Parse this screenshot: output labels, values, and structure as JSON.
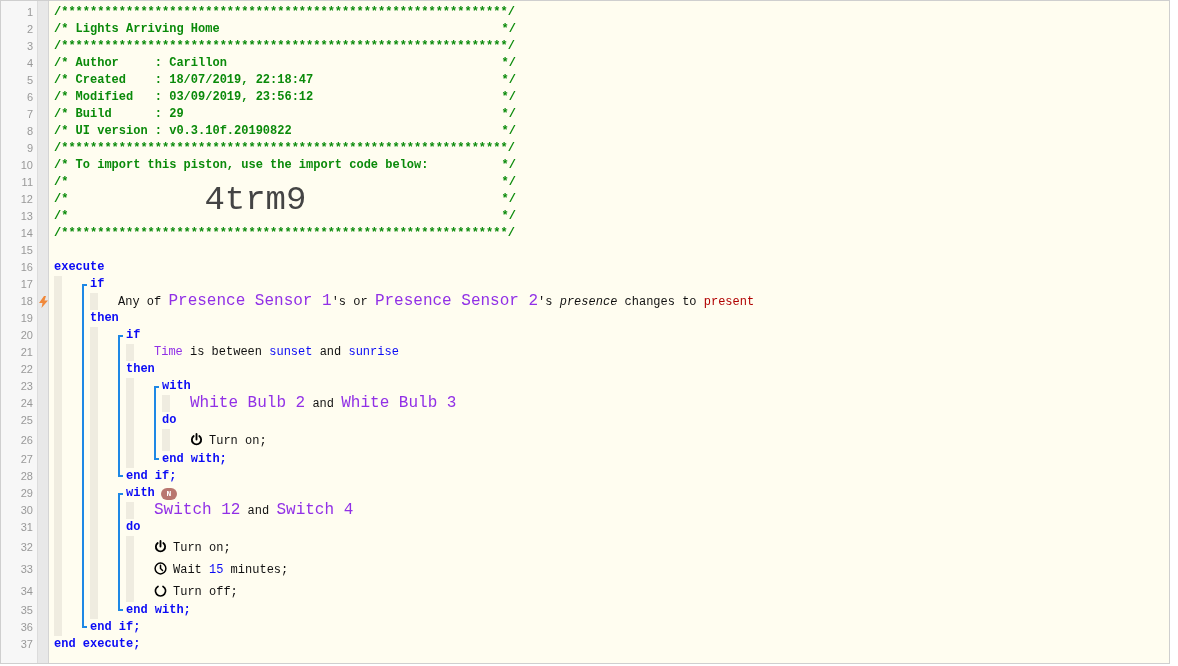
{
  "header": [
    {
      "number": "1",
      "left": "/**************************************************************/"
    },
    {
      "number": "2",
      "left": "/* Lights Arriving Home",
      "right": "*/"
    },
    {
      "number": "3",
      "left": "/**************************************************************/"
    },
    {
      "number": "4",
      "left": "/* Author     : Carillon",
      "right": "*/"
    },
    {
      "number": "5",
      "left": "/* Created    : 18/07/2019, 22:18:47",
      "right": "*/"
    },
    {
      "number": "6",
      "left": "/* Modified   : 03/09/2019, 23:56:12",
      "right": "*/"
    },
    {
      "number": "7",
      "left": "/* Build      : 29",
      "right": "*/"
    },
    {
      "number": "8",
      "left": "/* UI version : v0.3.10f.20190822",
      "right": "*/"
    },
    {
      "number": "9",
      "left": "/**************************************************************/"
    },
    {
      "number": "10",
      "left": "/* To import this piston, use the import code below:",
      "right": "*/"
    },
    {
      "number": "11",
      "left": "/*",
      "right": "*/"
    },
    {
      "number": "12",
      "left": "/*",
      "code": "4trm9",
      "right": "*/"
    },
    {
      "number": "13",
      "left": "/*",
      "right": "*/"
    },
    {
      "number": "14",
      "left": "/**************************************************************/"
    },
    {
      "number": "15"
    }
  ],
  "program": {
    "kind": "section",
    "parts": [
      {
        "line": {
          "number": "16",
          "tokens": [
            {
              "kind": "keyword",
              "text": "execute"
            }
          ]
        },
        "children": [
          {
            "kind": "block",
            "parts": [
              {
                "line": {
                  "number": "17",
                  "tokens": [
                    {
                      "kind": "keyword",
                      "text": "if"
                    }
                  ]
                },
                "children": [
                  {
                    "kind": "condition",
                    "trigger": true,
                    "number": "18",
                    "tokens": [
                      {
                        "kind": "text",
                        "text": "Any of "
                      },
                      {
                        "kind": "device",
                        "text": "Presence Sensor 1"
                      },
                      {
                        "kind": "text",
                        "text": "'s or "
                      },
                      {
                        "kind": "device",
                        "text": "Presence Sensor 2"
                      },
                      {
                        "kind": "text",
                        "text": "'s "
                      },
                      {
                        "kind": "attribute",
                        "text": "presence"
                      },
                      {
                        "kind": "text",
                        "text": " changes to "
                      },
                      {
                        "kind": "value",
                        "text": "present"
                      }
                    ]
                  }
                ]
              },
              {
                "line": {
                  "number": "19",
                  "tokens": [
                    {
                      "kind": "keyword",
                      "text": "then"
                    }
                  ]
                },
                "children": [
                  {
                    "kind": "block",
                    "parts": [
                      {
                        "line": {
                          "number": "20",
                          "tokens": [
                            {
                              "kind": "keyword",
                              "text": "if"
                            }
                          ]
                        },
                        "children": [
                          {
                            "kind": "condition",
                            "trigger": false,
                            "number": "21",
                            "tokens": [
                              {
                                "kind": "variable",
                                "text": "Time"
                              },
                              {
                                "kind": "text",
                                "text": " is between "
                              },
                              {
                                "kind": "constant",
                                "text": "sunset"
                              },
                              {
                                "kind": "text",
                                "text": " and "
                              },
                              {
                                "kind": "constant",
                                "text": "sunrise"
                              }
                            ]
                          }
                        ]
                      },
                      {
                        "line": {
                          "number": "22",
                          "tokens": [
                            {
                              "kind": "keyword",
                              "text": "then"
                            }
                          ]
                        },
                        "children": [
                          {
                            "kind": "block",
                            "parts": [
                              {
                                "line": {
                                  "number": "23",
                                  "tokens": [
                                    {
                                      "kind": "keyword",
                                      "text": "with"
                                    }
                                  ]
                                },
                                "children": [
                                  {
                                    "kind": "devices",
                                    "number": "24",
                                    "tokens": [
                                      {
                                        "kind": "device",
                                        "text": "White Bulb 2"
                                      },
                                      {
                                        "kind": "text",
                                        "text": " and "
                                      },
                                      {
                                        "kind": "device",
                                        "text": "White Bulb 3"
                                      }
                                    ]
                                  }
                                ]
                              },
                              {
                                "line": {
                                  "number": "25",
                                  "tokens": [
                                    {
                                      "kind": "keyword",
                                      "text": "do"
                                    }
                                  ]
                                },
                                "children": [
                                  {
                                    "kind": "turn_on",
                                    "number": "26",
                                    "tokens": [
                                      {
                                        "kind": "text",
                                        "text": "Turn on;"
                                      }
                                    ]
                                  }
                                ]
                              }
                            ],
                            "end": {
                              "number": "27",
                              "tokens": [
                                {
                                  "kind": "keyword",
                                  "text": "end with;"
                                }
                              ]
                            }
                          }
                        ]
                      }
                    ],
                    "end": {
                      "number": "28",
                      "tokens": [
                        {
                          "kind": "keyword",
                          "text": "end if;"
                        }
                      ]
                    }
                  },
                  {
                    "kind": "block",
                    "parts": [
                      {
                        "line": {
                          "number": "29",
                          "badge": "N",
                          "tokens": [
                            {
                              "kind": "keyword",
                              "text": "with"
                            }
                          ]
                        },
                        "children": [
                          {
                            "kind": "devices",
                            "number": "30",
                            "tokens": [
                              {
                                "kind": "device",
                                "text": "Switch 12"
                              },
                              {
                                "kind": "text",
                                "text": " and "
                              },
                              {
                                "kind": "device",
                                "text": "Switch 4"
                              }
                            ]
                          }
                        ]
                      },
                      {
                        "line": {
                          "number": "31",
                          "tokens": [
                            {
                              "kind": "keyword",
                              "text": "do"
                            }
                          ]
                        },
                        "children": [
                          {
                            "kind": "turn_on",
                            "number": "32",
                            "tokens": [
                              {
                                "kind": "text",
                                "text": "Turn on;"
                              }
                            ]
                          },
                          {
                            "kind": "wait",
                            "number": "33",
                            "tokens": [
                              {
                                "kind": "text",
                                "text": "Wait "
                              },
                              {
                                "kind": "number",
                                "text": "15"
                              },
                              {
                                "kind": "text",
                                "text": " minutes;"
                              }
                            ]
                          },
                          {
                            "kind": "turn_off",
                            "number": "34",
                            "tokens": [
                              {
                                "kind": "text",
                                "text": "Turn off;"
                              }
                            ]
                          }
                        ]
                      }
                    ],
                    "end": {
                      "number": "35",
                      "tokens": [
                        {
                          "kind": "keyword",
                          "text": "end with;"
                        }
                      ]
                    }
                  }
                ]
              }
            ],
            "end": {
              "number": "36",
              "tokens": [
                {
                  "kind": "keyword",
                  "text": "end if;"
                }
              ]
            }
          }
        ]
      }
    ],
    "end": {
      "number": "37",
      "tokens": [
        {
          "kind": "keyword",
          "text": "end execute;"
        }
      ]
    }
  }
}
